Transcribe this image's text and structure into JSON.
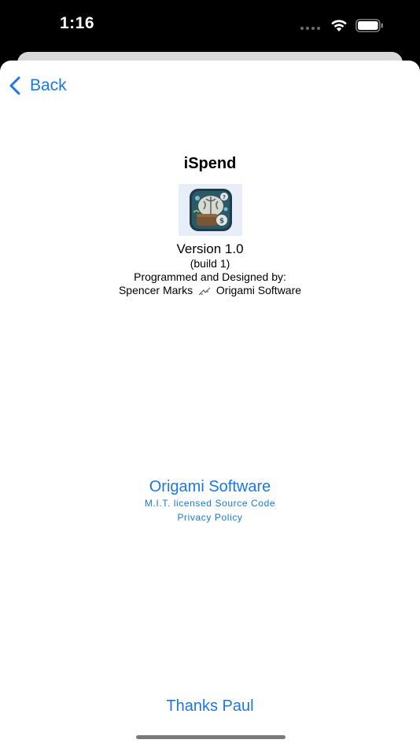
{
  "status_bar": {
    "time": "1:16",
    "icons": [
      "signal-dots-icon",
      "wifi-icon",
      "battery-icon"
    ]
  },
  "nav": {
    "back_label": "Back"
  },
  "about": {
    "app_name": "iSpend",
    "version": "Version 1.0",
    "build": "(build 1)",
    "credit_line": "Programmed and Designed by:",
    "author": "Spencer Marks",
    "company": "Origami Software"
  },
  "links": {
    "company_link": "Origami Software",
    "source_link": "M.I.T. licensed Source Code",
    "privacy_link": "Privacy Policy"
  },
  "footer": {
    "thanks_label": "Thanks Paul"
  },
  "colors": {
    "accent": "#1a78e0",
    "background": "#ffffff",
    "status_bar": "#000000"
  }
}
